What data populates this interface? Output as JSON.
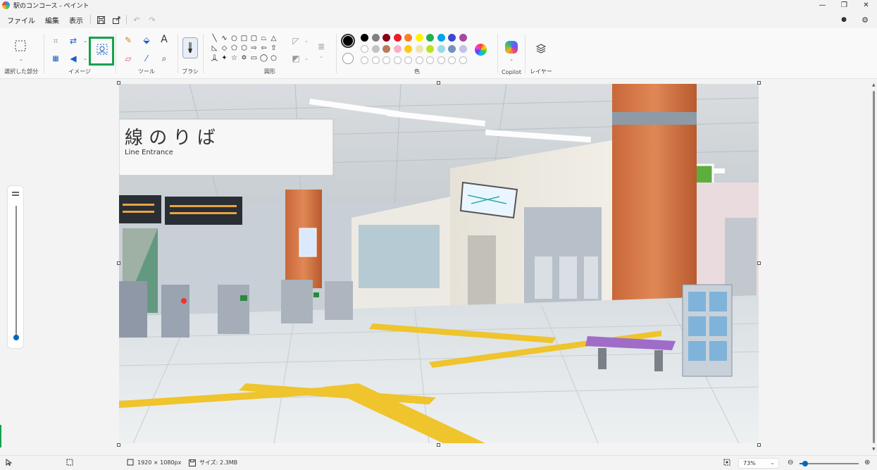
{
  "window": {
    "title": "駅のコンコース - ペイント",
    "minimize": "—",
    "restore": "❐",
    "close": "✕"
  },
  "menu": {
    "file": "ファイル",
    "edit": "編集",
    "view": "表示"
  },
  "ribbon": {
    "groups": {
      "selection": "選択した部分",
      "image": "イメージ",
      "tools": "ツール",
      "brush": "ブラシ",
      "shapes": "図形",
      "colors": "色",
      "copilot": "Copilot",
      "layers": "レイヤー"
    },
    "text_tool_glyph": "A",
    "primary_color": "#000000",
    "secondary_color": "#ffffff",
    "palette": [
      "#000000",
      "#7f7f7f",
      "#880015",
      "#ed1c24",
      "#ff7f27",
      "#fff200",
      "#22b14c",
      "#00a2e8",
      "#3f48cc",
      "#a349a4",
      "#ffffff",
      "#c3c3c3",
      "#b97a57",
      "#ffaec9",
      "#ffc90e",
      "#efe4b0",
      "#b5e61d",
      "#99d9ea",
      "#7092be",
      "#c8bfe7"
    ],
    "highlight_color": "#12a34a"
  },
  "status": {
    "dimensions": "1920 × 1080px",
    "size": "サイズ: 2.3MB",
    "zoom": "73%",
    "zoom_level": 0.1
  },
  "canvas": {
    "scene": {
      "sign_text": "線 の り ば",
      "sign_sub": "Line Entrance"
    }
  }
}
